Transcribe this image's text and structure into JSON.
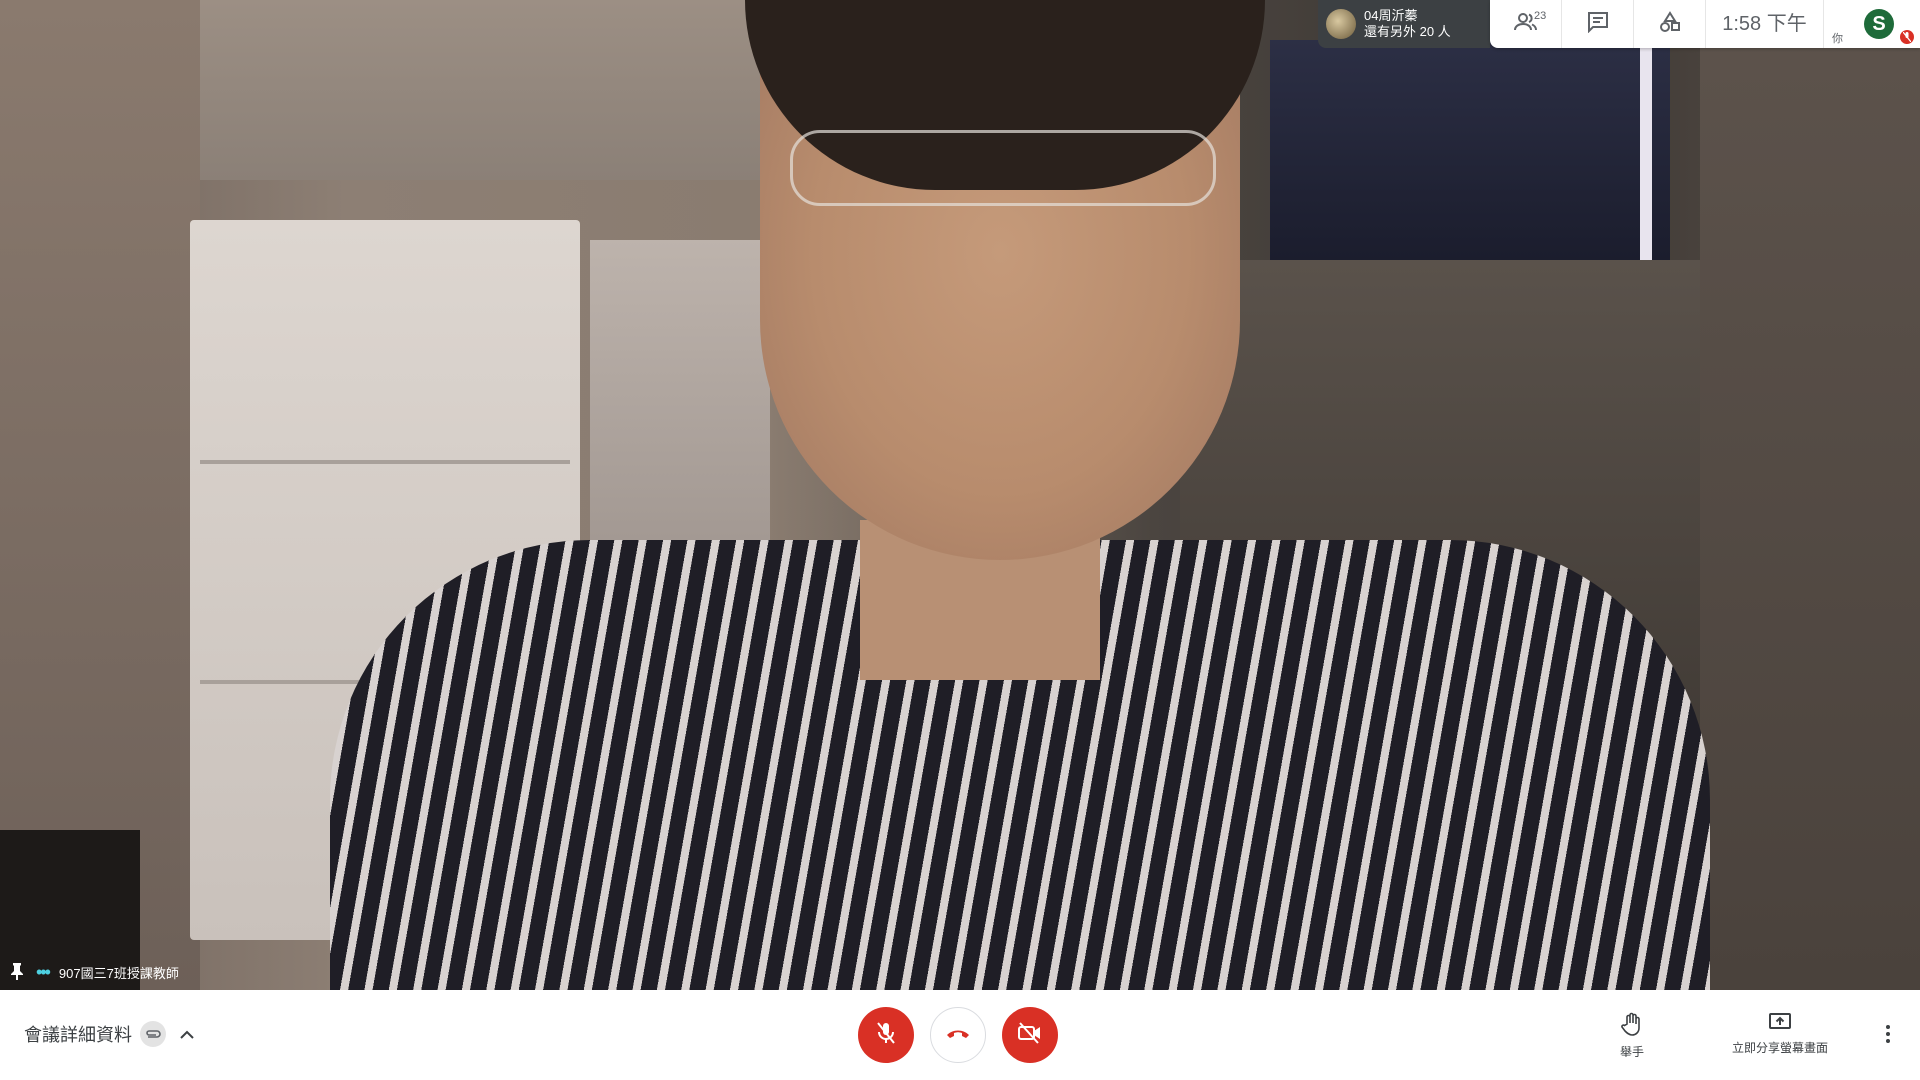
{
  "video": {
    "participant_name": "907國三7班授課教師",
    "pinned_icon": "pin-icon",
    "audio_activity_icon": "audio-dots-icon"
  },
  "speaker_chip": {
    "name": "04周沂蓁",
    "others": "還有另外 20 人"
  },
  "top_bar": {
    "people_count": "23",
    "time": "1:58 下午",
    "self_label": "你",
    "self_initial": "S",
    "icons": [
      "people-icon",
      "chat-icon",
      "activities-icon"
    ]
  },
  "bottom_bar": {
    "meeting_details_label": "會議詳細資料",
    "raise_hand_label": "舉手",
    "present_label": "立即分享螢幕畫面"
  },
  "colors": {
    "red": "#d93025",
    "accent_green": "#1e6b3a",
    "audio_dots": "#4dd0e1",
    "chip_bg": "#3c4043"
  }
}
